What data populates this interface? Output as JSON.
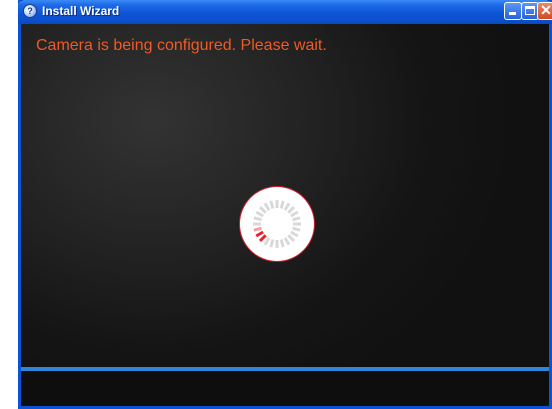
{
  "window": {
    "title": "Install Wizard",
    "icon": "wizard-icon"
  },
  "titlebar_buttons": {
    "minimize_icon": "minimize-icon",
    "maximize_icon": "maximize-icon",
    "close_icon": "close-icon"
  },
  "main": {
    "status_message": "Camera is being configured. Please wait.",
    "spinner_icon": "loading-spinner-icon"
  },
  "colors": {
    "accent": "#f15a22",
    "window_frame": "#0a53d6",
    "divider": "#2f86d8",
    "spinner_active": "#e8242c",
    "spinner_inactive": "#d9d9d9"
  }
}
